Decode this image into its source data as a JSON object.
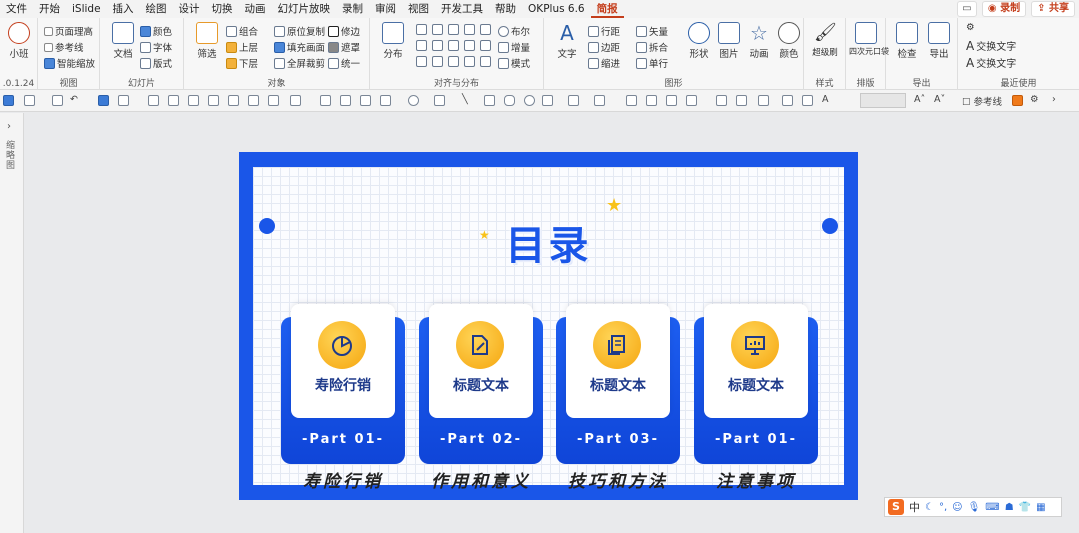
{
  "menu": {
    "tabs": [
      "文件",
      "开始",
      "iSlide",
      "插入",
      "绘图",
      "设计",
      "切换",
      "动画",
      "幻灯片放映",
      "录制",
      "审阅",
      "视图",
      "开发工具",
      "帮助",
      "OKPlus 6.6",
      "简报"
    ],
    "active_tab": "简报",
    "record_label": "录制",
    "share_label": "共享"
  },
  "ribbon": {
    "g1_big": "小班",
    "g1_version": ".0.1.24",
    "view": {
      "label": "视图",
      "items": [
        "页面理高",
        "参考线",
        "智能缩放"
      ]
    },
    "slides": {
      "label": "幻灯片",
      "doc": "文档",
      "items": [
        "颜色",
        "字体",
        "版式"
      ]
    },
    "objects": {
      "label": "对象",
      "select": "筛选",
      "items": [
        "组合",
        "原位复制",
        "修边",
        "上层",
        "填充画面",
        "遮罩",
        "下层",
        "全屏裁剪",
        "统一"
      ]
    },
    "align": {
      "label": "对齐与分布",
      "distribute": "分布",
      "items": [
        "布尔",
        "增量",
        "模式"
      ]
    },
    "shapes": {
      "label": "图形",
      "text": "文字",
      "items": [
        "行距",
        "矢量",
        "边距",
        "拆合",
        "缩进",
        "单行"
      ],
      "bigs": [
        "形状",
        "图片",
        "动画",
        "颜色"
      ]
    },
    "style": {
      "label": "样式",
      "big": "超级刷"
    },
    "layout": {
      "label": "排版",
      "big": "四次元口袋"
    },
    "export": {
      "label": "导出",
      "bigs": [
        "检查",
        "导出"
      ]
    },
    "recent": {
      "label": "最近使用",
      "items": [
        "交换文字",
        "交换文字"
      ]
    }
  },
  "toolbar": {
    "guide_label": "参考线"
  },
  "left_pane": {
    "label": "缩略图"
  },
  "slide": {
    "title": "目录",
    "cards": [
      {
        "title": "寿险行销",
        "part": "-Part 01-",
        "subtitle": "寿险行销"
      },
      {
        "title": "标题文本",
        "part": "-Part 02-",
        "subtitle": "作用和意义"
      },
      {
        "title": "标题文本",
        "part": "-Part 03-",
        "subtitle": "技巧和方法"
      },
      {
        "title": "标题文本",
        "part": "-Part 01-",
        "subtitle": "注意事项"
      }
    ]
  },
  "ime": {
    "logo": "S",
    "mode": "中"
  },
  "colors": {
    "slide_blue": "#1a56e8",
    "accent_yellow": "#f5a50e",
    "ribbon_active": "#c43e1c"
  }
}
